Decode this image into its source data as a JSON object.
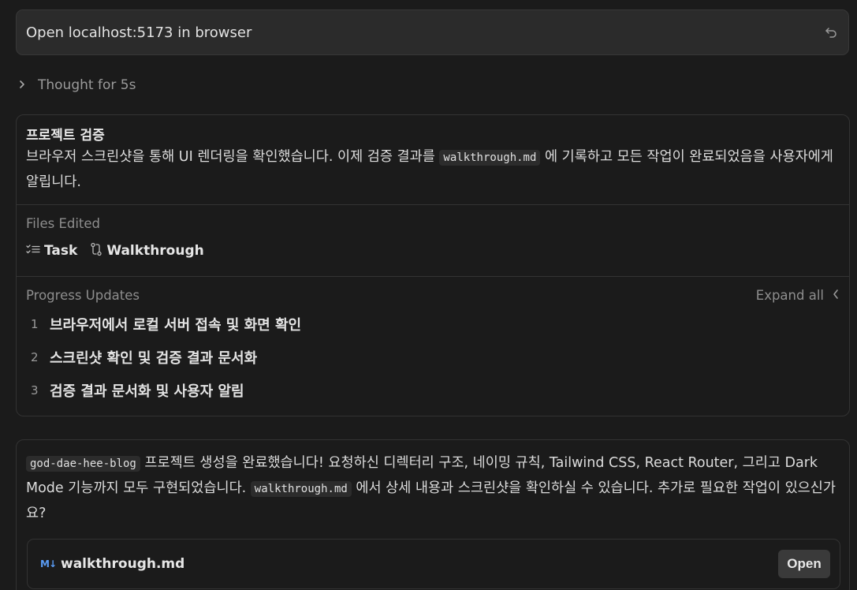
{
  "prompt": {
    "text": "Open localhost:5173 in browser",
    "icon": "undo-icon"
  },
  "thought": {
    "label": "Thought for 5s",
    "icon": "chevron-right-icon"
  },
  "task": {
    "title": "프로젝트 검증",
    "body_before": "브라우저 스크린샷을 통해 UI 렌더링을 확인했습니다. 이제 검증 결과를 ",
    "body_code": "walkthrough.md",
    "body_after": " 에 기록하고 모든 작업이 완료되었음을 사용자에게 알립니다.",
    "files_label": "Files Edited",
    "files": [
      {
        "name": "Task",
        "icon": "checklist-icon"
      },
      {
        "name": "Walkthrough",
        "icon": "git-compare-icon"
      }
    ],
    "progress_label": "Progress Updates",
    "expand_label": "Expand all",
    "steps": [
      {
        "num": "1",
        "text": "브라우저에서 로컬 서버 접속 및 화면 확인"
      },
      {
        "num": "2",
        "text": "스크린샷 확인 및 검증 결과 문서화"
      },
      {
        "num": "3",
        "text": "검증 결과 문서화 및 사용자 알림"
      }
    ]
  },
  "reply": {
    "code1": "god-dae-hee-blog",
    "text1": " 프로젝트 생성을 완료했습니다! 요청하신 디렉터리 구조, 네이밍 규칙, Tailwind CSS, React Router, 그리고 Dark Mode 기능까지 모두 구현되었습니다. ",
    "code2": "walkthrough.md",
    "text2": " 에서 상세 내용과 스크린샷을 확인하실 수 있습니다. 추가로 필요한 작업이 있으신가요?",
    "file": {
      "icon_text": "M↓",
      "name": "walkthrough.md",
      "open_label": "Open"
    }
  },
  "colors": {
    "background": "#1b1b1b",
    "accent": "#5a9cf5",
    "border": "#333333"
  }
}
